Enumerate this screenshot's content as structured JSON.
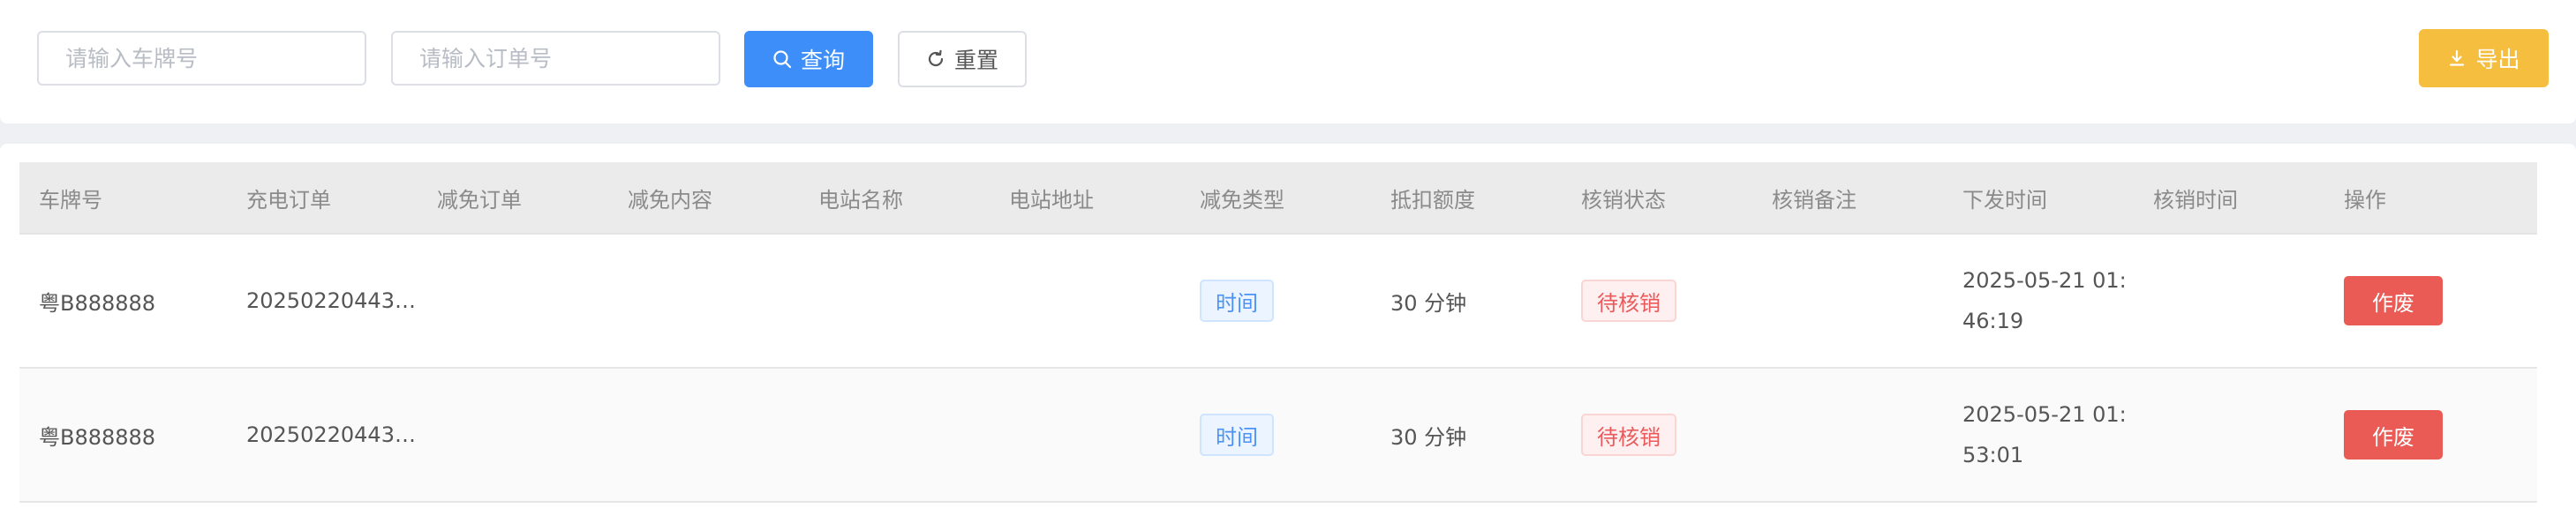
{
  "search": {
    "plate_placeholder": "请输入车牌号",
    "order_placeholder": "请输入订单号",
    "query_label": "查询",
    "reset_label": "重置",
    "export_label": "导出"
  },
  "colors": {
    "primary": "#3d8ef8",
    "warning": "#f6be3f",
    "danger": "#eb5b56"
  },
  "table": {
    "headers": [
      "车牌号",
      "充电订单",
      "减免订单",
      "减免内容",
      "电站名称",
      "电站地址",
      "减免类型",
      "抵扣额度",
      "核销状态",
      "核销备注",
      "下发时间",
      "核销时间",
      "操作"
    ],
    "rows": [
      {
        "plate": "粤B888888",
        "charge_order": "20250220443…",
        "relief_order": "",
        "relief_content": "",
        "station_name": "",
        "station_address": "",
        "relief_type": "时间",
        "deduction": "30 分钟",
        "status": "待核销",
        "remark": "",
        "issue_time_line1": "2025-05-21 01:",
        "issue_time_line2": "46:19",
        "verify_time": "",
        "action": "作废"
      },
      {
        "plate": "粤B888888",
        "charge_order": "20250220443…",
        "relief_order": "",
        "relief_content": "",
        "station_name": "",
        "station_address": "",
        "relief_type": "时间",
        "deduction": "30 分钟",
        "status": "待核销",
        "remark": "",
        "issue_time_line1": "2025-05-21 01:",
        "issue_time_line2": "53:01",
        "verify_time": "",
        "action": "作废"
      }
    ]
  }
}
